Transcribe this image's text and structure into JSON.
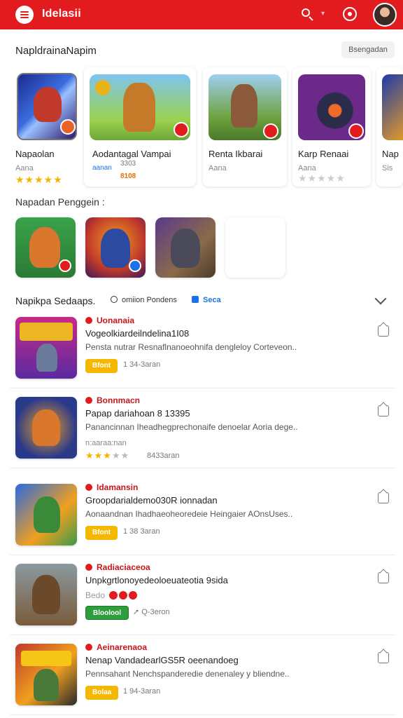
{
  "header": {
    "brand": "Idelasii"
  },
  "featured": {
    "title": "NapldrainaNapim",
    "see_more": "Bsengadan",
    "cards": [
      {
        "name": "Napaolan",
        "sub": "Aana",
        "stars": 5
      },
      {
        "name": "Aodantagal Vampai",
        "sub": "aanan",
        "badge": "3303",
        "price": "8108"
      },
      {
        "name": "Renta Ikbarai",
        "sub": "Aana"
      },
      {
        "name": "Karp Renaai",
        "sub": "Aana",
        "stars": 0
      },
      {
        "name": "Nap",
        "sub": "Sis"
      }
    ]
  },
  "popular": {
    "title": "Napadan Penggein :"
  },
  "filters": {
    "label": "Napikpa Sedaaps.",
    "chip1": "omiion Pondens",
    "chip2": "Seca"
  },
  "list": [
    {
      "dev": "Uonanaia",
      "title": "Vogeolkiardeilndelina1I08",
      "desc": "Pensta nutrar Resnaflnanoeohnifa dengleloy Corteveon..",
      "btn": "Bfont",
      "meta": "1 34-3aran"
    },
    {
      "dev": "Bonnmacn",
      "title": "Papap dariahoan 8 13395",
      "desc": "Panancinnan Iheadhegprechonaife denoelar Aoria dege..",
      "sub": "n:aaraa:nan",
      "stars": 3,
      "meta": "8433aran"
    },
    {
      "dev": "Idamansin",
      "title": "Groopdarialdemo030R ionnadan",
      "desc": "Aonaandnan Ihadhaeoheoredeie Heingaier AOnsUses..",
      "btn": "Bfont",
      "meta": "1 38 3aran"
    },
    {
      "dev": "Radiaciaceoa",
      "title": "Unpkgrtlonoyedeoloeuateotia 9sida",
      "desc": "",
      "btn": "Bloolool",
      "meta": "Q-3eron",
      "reds": "Bedo"
    },
    {
      "dev": "Aeinarenaoa",
      "title": "Nenap VandadearlGS5R  oeenandoeg",
      "desc": "Pennsahant Nenchspanderedie denenaley y bliendne..",
      "btn": "Bolaa",
      "meta": "1 94-3aran"
    }
  ]
}
